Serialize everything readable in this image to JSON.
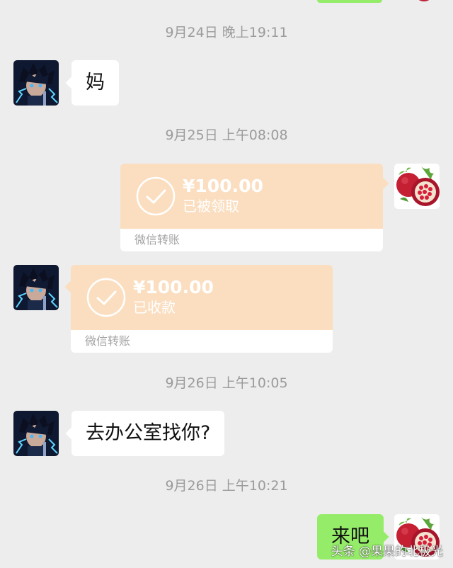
{
  "messages": [
    {
      "timestamp": "9月24日 晚上19:11",
      "sender": "other",
      "text": "妈"
    },
    {
      "timestamp": "9月25日 上午08:08",
      "sender": "me",
      "type": "transfer",
      "amount": "¥100.00",
      "status": "已被领取",
      "label": "微信转账"
    },
    {
      "sender": "other",
      "type": "transfer",
      "amount": "¥100.00",
      "status": "已收款",
      "label": "微信转账"
    },
    {
      "timestamp": "9月26日 上午10:05",
      "sender": "other",
      "text": "去办公室找你?"
    },
    {
      "timestamp": "9月26日 上午10:21",
      "sender": "me",
      "text": "来吧"
    }
  ],
  "avatars": {
    "other": "anime-character-avatar",
    "me": "pomegranate-avatar"
  },
  "colors": {
    "background": "#ededed",
    "my_bubble": "#95ec69",
    "other_bubble": "#ffffff",
    "transfer_card": "#fbdec0",
    "timestamp_text": "#9b9b9b"
  },
  "watermark": "头条 @果果的北极光"
}
